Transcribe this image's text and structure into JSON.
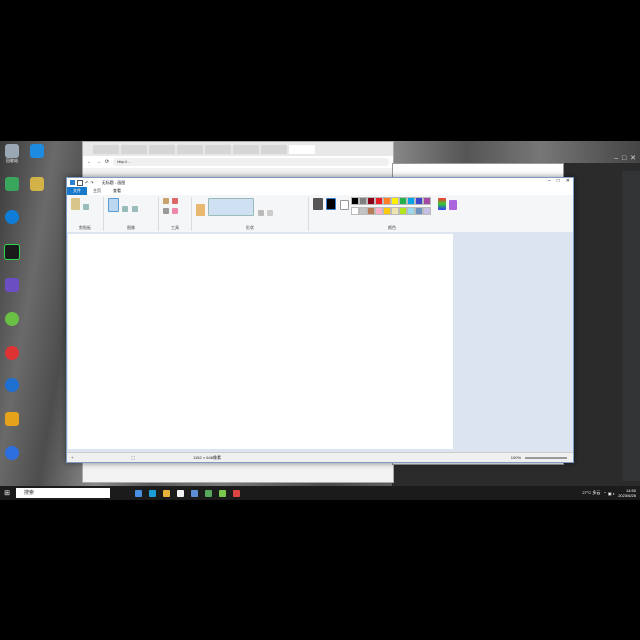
{
  "desktop": {
    "icons": [
      {
        "label": "回收站",
        "color": "#9aa7b5"
      },
      {
        "label": "",
        "color": "#1d8be0"
      },
      {
        "label": "",
        "color": "#3aa55c"
      },
      {
        "label": "",
        "color": "#d4b24a"
      },
      {
        "label": "",
        "color": "#0f7dd8"
      },
      {
        "label": "",
        "color": "#2bb2d8"
      },
      {
        "label": "",
        "color": "#6b4fc2"
      },
      {
        "label": "",
        "color": "#6abf45"
      },
      {
        "label": "",
        "color": "#d33"
      },
      {
        "label": "",
        "color": "#1f6fd1"
      },
      {
        "label": "",
        "color": "#e7a21b"
      },
      {
        "label": "",
        "color": "#2e6fe0"
      }
    ]
  },
  "browser": {
    "tabs": [
      "",
      "",
      "",
      "",
      "",
      "",
      "",
      ""
    ],
    "active_tab": 7,
    "url": "http://...",
    "controls": [
      "←",
      "→",
      "⟳"
    ]
  },
  "paint": {
    "title": "无标题 - 画图",
    "title_controls": [
      "–",
      "□",
      "✕"
    ],
    "menu": {
      "file": "文件",
      "home": "主页",
      "view": "查看"
    },
    "groups": {
      "clipboard": "剪贴板",
      "image": "图像",
      "tools": "工具",
      "shapes": "形状",
      "colors": "颜色"
    },
    "palette": [
      "#000000",
      "#7f7f7f",
      "#880015",
      "#ed1c24",
      "#ff7f27",
      "#fff200",
      "#22b14c",
      "#00a2e8",
      "#3f48cc",
      "#a349a4",
      "#ffffff",
      "#c3c3c3",
      "#b97a57",
      "#ffaec9",
      "#ffc90e",
      "#efe4b0",
      "#b5e61d",
      "#99d9ea",
      "#7092be",
      "#c8bfe7"
    ],
    "status": {
      "canvas_size": "1152 × 648像素",
      "zoom": "100%"
    }
  },
  "taskbar": {
    "search_placeholder": "搜索",
    "weather": "27°C 多云",
    "time": "14:50",
    "date": "2023/6/26",
    "apps": [
      "#4a90e2",
      "#1b9ed8",
      "#e8b23b",
      "#f2f2f2",
      "#5c8fd6",
      "#56a85a",
      "#7ac74f",
      "#d44"
    ]
  }
}
